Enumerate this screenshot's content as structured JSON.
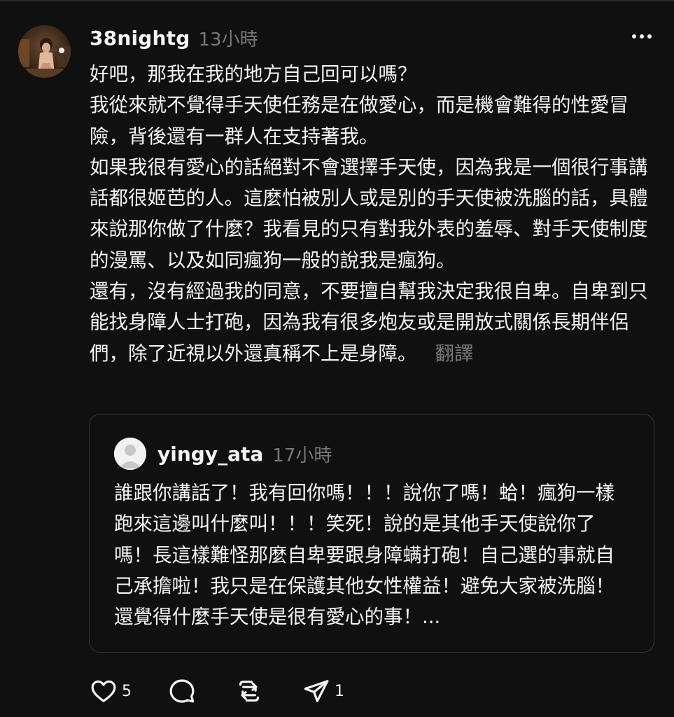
{
  "post": {
    "username": "38nightg",
    "timestamp": "13小時",
    "paragraphs": [
      "好吧，那我在我的地方自己回可以嗎？",
      "我從來就不覺得手天使任務是在做愛心，而是機會難得的性愛冒險，背後還有一群人在支持著我。",
      "如果我很有愛心的話絕對不會選擇手天使，因為我是一個很行事講話都很姬芭的人。這麼怕被別人或是別的手天使被洗腦的話，具體來說那你做了什麼？我看見的只有對我外表的羞辱、對手天使制度的漫罵、以及如同瘋狗一般的說我是瘋狗。",
      "還有，沒有經過我的同意，不要擅自幫我決定我很自卑。自卑到只能找身障人士打砲，因為我有很多炮友或是開放式關係長期伴侶們，除了近視以外還真稱不上是身障。"
    ],
    "translate_label": "翻譯"
  },
  "quote": {
    "username": "yingy_ata",
    "timestamp": "17小時",
    "text": "誰跟你講話了！我有回你嗎！！！說你了嗎！蛤！瘋狗一樣跑來這邊叫什麼叫！！！笑死！說的是其他手天使說你了嗎！長這樣難怪那麼自卑要跟身障螨打砲！自己選的事就自己承擔啦！我只是在保護其他女性權益！避免大家被洗腦！還覺得什麼手天使是很有愛心的事！..."
  },
  "actions": {
    "like_count": "5",
    "repost_count": "1"
  },
  "icons": {
    "more": "more-horizontal-icon",
    "like": "heart-icon",
    "comment": "comment-icon",
    "repost": "repost-icon",
    "share": "send-icon"
  },
  "colors": {
    "background": "#101010",
    "text": "#f3f5f7",
    "secondary_text": "#777777",
    "border": "#333638"
  }
}
